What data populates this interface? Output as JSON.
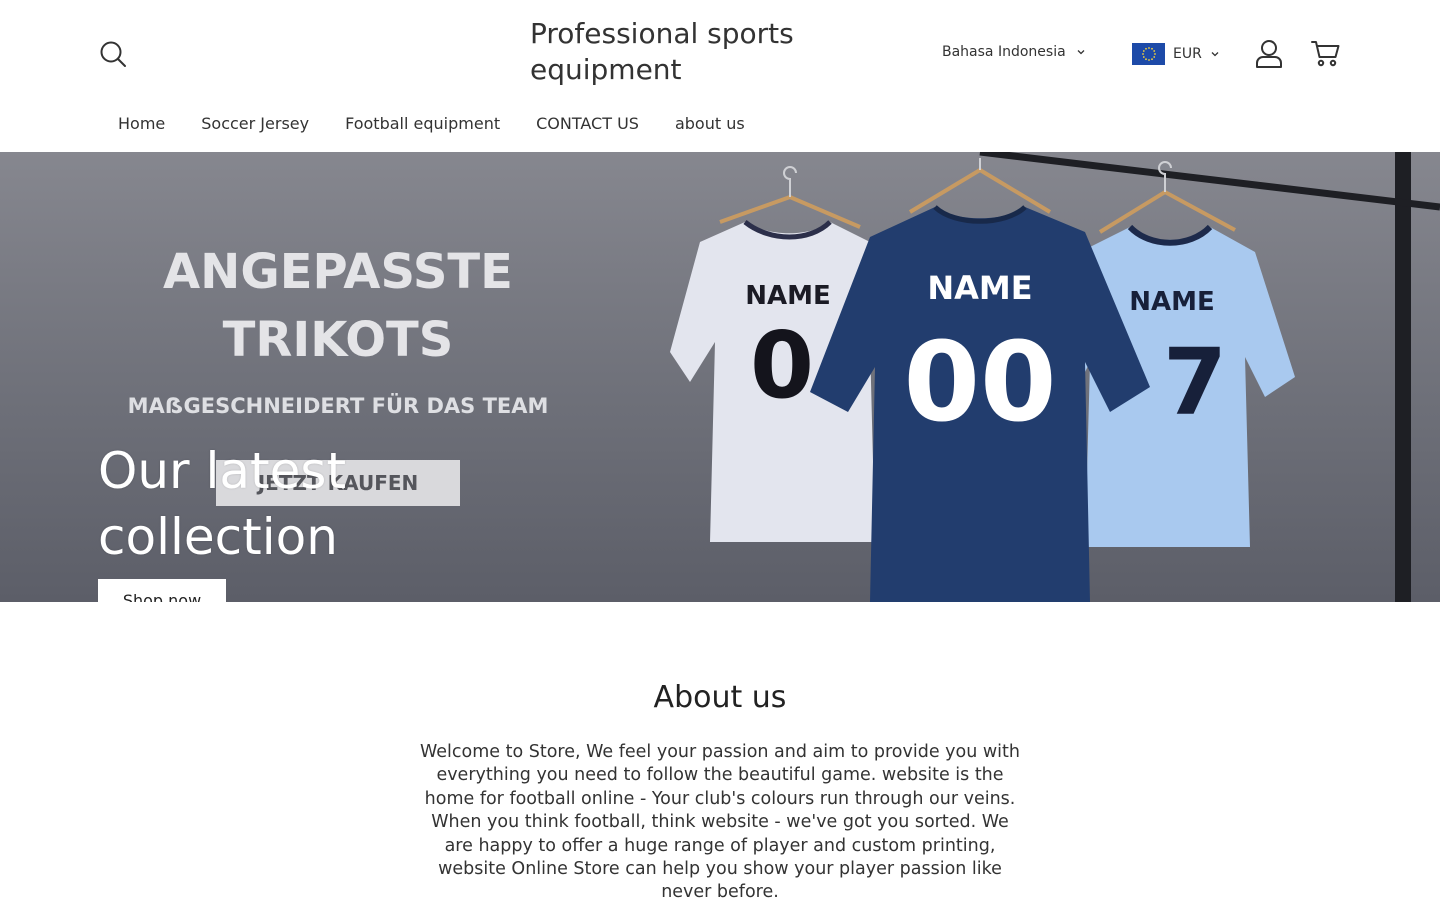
{
  "header": {
    "site_title": "Professional sports equipment",
    "language": "Bahasa Indonesia",
    "currency": "EUR",
    "icons": [
      "search-icon",
      "chevron-down-icon",
      "eu-flag-icon",
      "account-icon",
      "cart-icon"
    ]
  },
  "nav": {
    "items": [
      "Home",
      "Soccer Jersey",
      "Football equipment",
      "CONTACT US",
      "about us"
    ]
  },
  "hero": {
    "heading": "Our latest collection",
    "button_label": "Shop now",
    "banner_text": {
      "line1": "ANGEPASSTE",
      "line2": "TRIKOTS",
      "line3": "MAẞGESCHNEIDERT FÜR DAS TEAM",
      "cta": "JETZT KAUFEN"
    },
    "jerseys": [
      {
        "name": "NAME",
        "number": "0",
        "color": "#e6e8f0"
      },
      {
        "name": "NAME",
        "number": "00",
        "color": "#223d6e"
      },
      {
        "name": "NAME",
        "number": "7",
        "color": "#a7c8ee"
      }
    ]
  },
  "about": {
    "title": "About us",
    "body": "Welcome to Store, We feel your passion and aim to provide you with everything you need to follow the beautiful game. website is the home for football online - Your club's colours run through our veins. When you think football, think website - we've got you sorted. We are happy to offer a huge range of player and custom printing, website Online Store can help you show your player passion like never before."
  },
  "colors": {
    "flag_blue": "#1d4aa8",
    "text": "#333333"
  }
}
